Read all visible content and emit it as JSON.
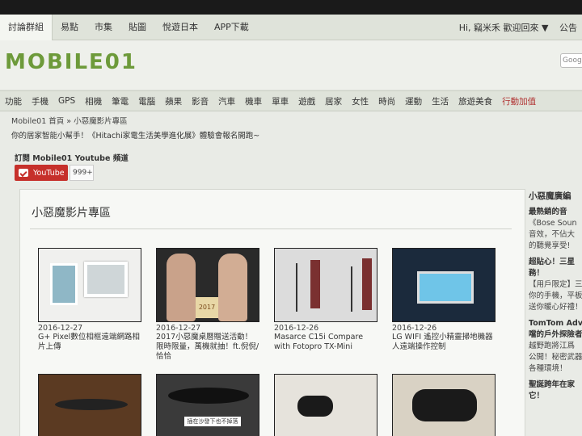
{
  "topbar": {
    "tabs": [
      "討論群組",
      "易點",
      "市集",
      "貼圖",
      "悅遊日本",
      "APP下載"
    ],
    "greeting": "Hi, 竊米禾 歡迎回來 ▼",
    "right_link": "公告"
  },
  "header": {
    "logo": "MOBILE01",
    "search_placeholder": "Goog"
  },
  "navbar": {
    "items": [
      "功能",
      "手機",
      "GPS",
      "相機",
      "筆電",
      "電腦",
      "蘋果",
      "影音",
      "汽車",
      "機車",
      "單車",
      "遊戲",
      "居家",
      "女性",
      "時尚",
      "運動",
      "生活",
      "旅遊美食",
      "行動加值"
    ]
  },
  "breadcrumb": "Mobile01 首頁 » 小惡魔影片專區",
  "announcement": "你的居家智能小幫手！《Hitachi家電生活美學進化展》體驗會報名開跑~",
  "subscribe": {
    "label": "訂閱 Mobile01 Youtube 頻道",
    "button": "YouTube",
    "count": "999+"
  },
  "panel": {
    "title": "小惡魔影片專區",
    "videos": [
      {
        "date": "2016-12-27",
        "title": "G+ Pixel數位相框遠端網路相片上傳"
      },
      {
        "date": "2016-12-27",
        "title": "2017小惡魔桌曆贈送活動！限時限量，萬機就抽！ft.倪倪/恰恰"
      },
      {
        "date": "2016-12-26",
        "title": "Masarce C15i Compare with Fotopro TX-Mini"
      },
      {
        "date": "2016-12-26",
        "title": "LG WIFI 遙控小精靈掃地機器人遠端操作控制"
      },
      {
        "date": "",
        "title": ""
      },
      {
        "date": "",
        "title": ""
      },
      {
        "date": "",
        "title": ""
      },
      {
        "date": "",
        "title": ""
      }
    ],
    "thumb_captions": [
      "2017",
      "插在沙發下也不掉落"
    ]
  },
  "sidebar": {
    "title": "小惡魔廣編",
    "lines": [
      {
        "text": "最熱銷的音",
        "bold": true
      },
      {
        "text": "《Bose Soun",
        "bold": false
      },
      {
        "text": "音效，不佔大",
        "bold": false
      },
      {
        "text": "的聽覺享受!",
        "bold": false
      },
      {
        "text": "超貼心！三星",
        "bold": true
      },
      {
        "text": "務！",
        "bold": true
      },
      {
        "text": "【用戶限定】三",
        "bold": false
      },
      {
        "text": "你的手機，平板",
        "bold": false
      },
      {
        "text": "送你暖心好禮！",
        "bold": false
      },
      {
        "text": "TomTom Adve",
        "bold": true
      },
      {
        "text": "噹的戶外探險者",
        "bold": true
      },
      {
        "text": "越野跑將江爲",
        "bold": false
      },
      {
        "text": "公開！秘密武器",
        "bold": false
      },
      {
        "text": "各種環境！",
        "bold": false
      },
      {
        "text": "聖誕跨年在家",
        "bold": true
      },
      {
        "text": "它！",
        "bold": true
      }
    ]
  }
}
